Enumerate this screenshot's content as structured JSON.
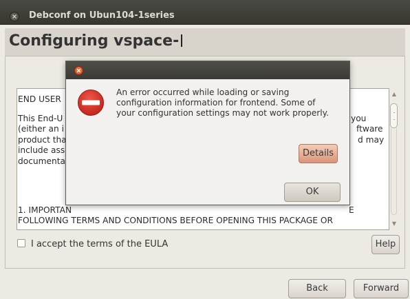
{
  "titlebar": {
    "title": "Debconf on Ubun104-1series"
  },
  "header": {
    "title": "Configuring vspace-"
  },
  "eula": {
    "lines": {
      "l1": "END USER",
      "l2": "This End-U",
      "l2r": "you",
      "l3": "(either an i",
      "l3r": "ftware",
      "l4": "product tha",
      "l4r": "d may",
      "l5": "include ass",
      "l6": "documenta",
      "l7": "1. IMPORTAN",
      "l7r": "E",
      "l8": "FOLLOWING TERMS AND CONDITIONS BEFORE OPENING THIS PACKAGE OR"
    }
  },
  "accept": {
    "label": "I accept the terms of the EULA"
  },
  "buttons": {
    "help": "Help",
    "back": "Back",
    "forward": "Forward"
  },
  "dialog": {
    "message_lines": {
      "m1": "An error occurred while loading or saving",
      "m2": "configuration information for frontend. Some of",
      "m3": "your configuration settings may not work properly."
    },
    "details": "Details",
    "ok": "OK",
    "icon": "error-icon"
  },
  "colors": {
    "accent": "#dd4814",
    "titlebar": "#3c3b37",
    "error": "#d6372d"
  }
}
